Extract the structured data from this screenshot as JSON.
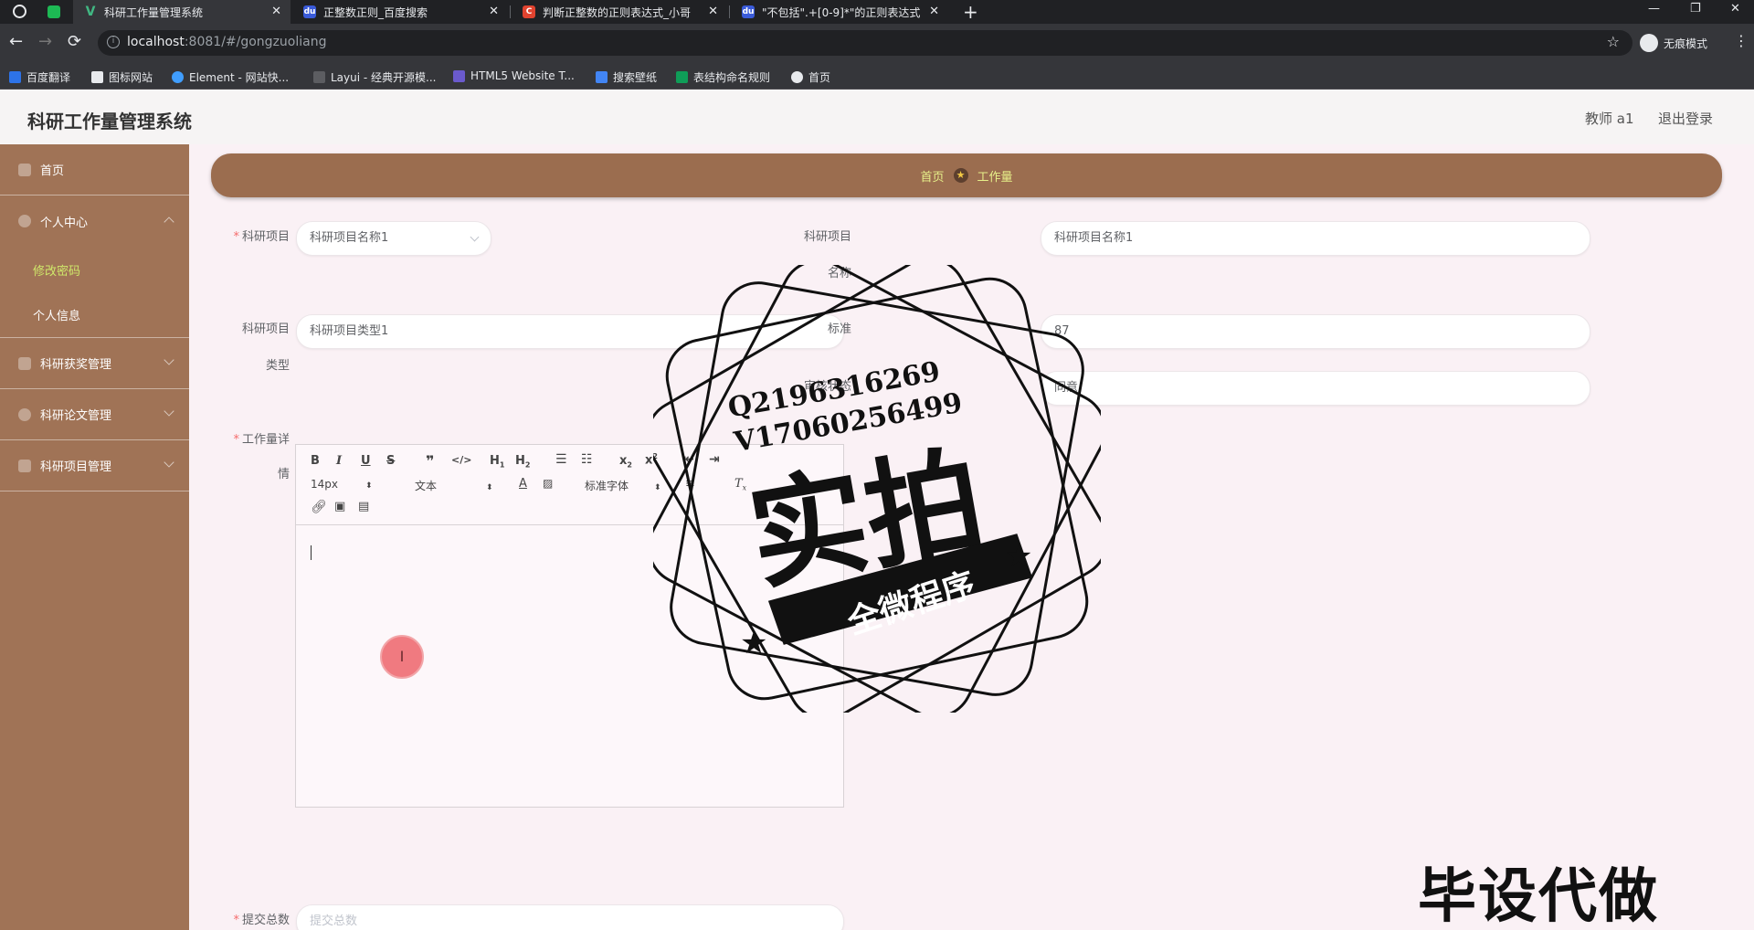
{
  "browser": {
    "tabs": [
      {
        "title": "科研工作量管理系统",
        "active": true
      },
      {
        "title": "正整数正则_百度搜索"
      },
      {
        "title": "判断正整数的正则表达式_小哥"
      },
      {
        "title": "\"不包括\".+[0-9]*\"的正则表达式"
      }
    ],
    "url_host": "localhost",
    "url_rest": ":8081/#/gongzuoliang",
    "incognito_label": "无痕模式",
    "bookmarks": [
      "百度翻译",
      "图标网站",
      "Element - 网站快...",
      "Layui - 经典开源模...",
      "HTML5 Website T...",
      "搜索壁纸",
      "表结构命名规则",
      "首页"
    ]
  },
  "header": {
    "title": "科研工作量管理系统",
    "user": "教师 a1",
    "logout": "退出登录"
  },
  "sidebar": {
    "home": "首页",
    "personal_center": "个人中心",
    "change_password": "修改密码",
    "personal_info": "个人信息",
    "award_mgmt": "科研获奖管理",
    "paper_mgmt": "科研论文管理",
    "project_mgmt": "科研项目管理"
  },
  "breadcrumb": {
    "home": "首页",
    "current": "工作量"
  },
  "form": {
    "project_label": "科研项目",
    "project_value": "科研项目名称1",
    "project_name_label_1": "科研项目",
    "project_name_label_2": "名称",
    "project_name_value": "科研项目名称1",
    "project_type_label_1": "科研项目",
    "project_type_label_2": "类型",
    "project_type_value": "科研项目类型1",
    "standard_label": "标准",
    "standard_value": "87",
    "audit_label": "审核状态",
    "audit_value": "同意",
    "detail_label_1": "工作量详",
    "detail_label_2": "情",
    "total_label": "提交总数",
    "total_placeholder": "提交总数"
  },
  "editor": {
    "font_size": "14px",
    "block_type": "文本",
    "font_family": "标准字体"
  },
  "watermark": {
    "qq": "Q2196316269",
    "wechat": "V17060256499",
    "main": "实拍",
    "ribbon": "全微程序",
    "corner": "毕设代做"
  },
  "colors": {
    "sidebar": "#a07356",
    "breadcrumb_bar": "#9b6d4f",
    "active_link": "#cfe86a",
    "main_bg": "#faf1f5"
  }
}
